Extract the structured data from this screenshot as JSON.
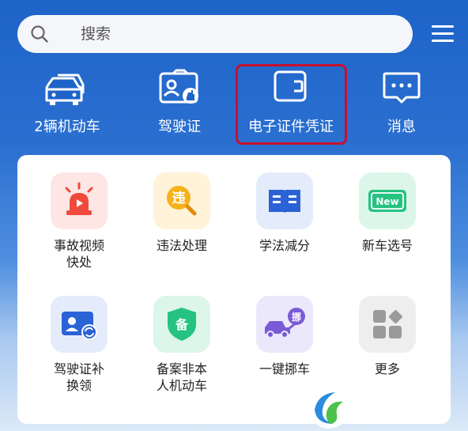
{
  "search": {
    "placeholder": "搜索"
  },
  "top_nav": [
    {
      "label": "2辆机动车",
      "icon": "car-icon"
    },
    {
      "label": "驾驶证",
      "icon": "license-icon"
    },
    {
      "label": "电子证件凭证",
      "icon": "wallet-icon",
      "highlighted": true
    },
    {
      "label": "消息",
      "icon": "message-icon"
    }
  ],
  "services": [
    {
      "line1": "事故视频",
      "line2": "快处",
      "icon": "alarm-icon"
    },
    {
      "line1": "违法处理",
      "line2": "",
      "icon": "violation-icon",
      "glyph": "违"
    },
    {
      "line1": "学法减分",
      "line2": "",
      "icon": "book-icon"
    },
    {
      "line1": "新车选号",
      "line2": "",
      "icon": "plate-icon",
      "glyph": "New"
    },
    {
      "line1": "驾驶证补",
      "line2": "换领",
      "icon": "license-renew-icon"
    },
    {
      "line1": "备案非本",
      "line2": "人机动车",
      "icon": "shield-icon",
      "glyph": "备"
    },
    {
      "line1": "一键挪车",
      "line2": "",
      "icon": "truck-icon",
      "glyph": "挪"
    },
    {
      "line1": "更多",
      "line2": "",
      "icon": "more-icon"
    }
  ],
  "colors": {
    "header_blue": "#1e63c8",
    "highlight_red": "#c8102e"
  }
}
